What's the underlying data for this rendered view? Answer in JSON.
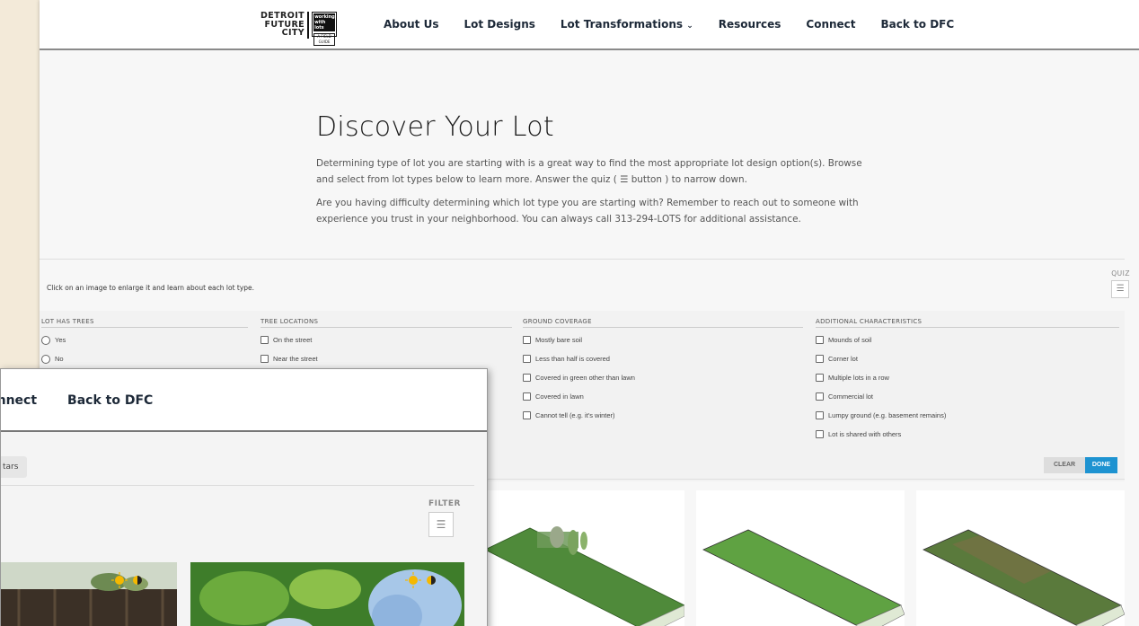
{
  "main": {
    "logo": {
      "line1": "DETROIT",
      "line2": "FUTURE",
      "line3": "CITY",
      "box_line1": "working",
      "box_line2": "with lots",
      "box_sub": "A FIELD GUIDE"
    },
    "nav": [
      "About Us",
      "Lot Designs",
      "Lot Transformations",
      "Resources",
      "Connect",
      "Back to DFC"
    ],
    "hero": {
      "title": "Discover Your Lot",
      "para1": "Determining type of lot you are starting with is a great way to find the most appropriate lot design option(s). Browse and select from lot types below to learn more. Answer the quiz ( ☰ button ) to narrow down.",
      "para2": "Are you having difficulty determining which lot type you are starting with? Remember to reach out to someone with experience you trust in your neighborhood. You can always call 313-294-LOTS for additional assistance."
    },
    "instructions": "Click on an image to enlarge it and learn about each lot type.",
    "quiz_label": "QUIZ",
    "filters": {
      "trees": {
        "head": "LOT HAS TREES",
        "options": [
          "Yes",
          "No"
        ]
      },
      "locations": {
        "head": "TREE LOCATIONS",
        "options": [
          "On the street",
          "Near the street"
        ]
      },
      "ground": {
        "head": "GROUND COVERAGE",
        "options": [
          "Mostly bare soil",
          "Less than half is covered",
          "Covered in green other than lawn",
          "Covered in lawn",
          "Cannot tell (e.g. it's winter)"
        ]
      },
      "additional": {
        "head": "ADDITIONAL CHARACTERISTICS",
        "options": [
          "Mounds of soil",
          "Corner lot",
          "Multiple lots in a row",
          "Commercial lot",
          "Lumpy ground (e.g. basement remains)",
          "Lot is shared with others"
        ]
      }
    },
    "clear_label": "CLEAR",
    "done_label": "DONE"
  },
  "overlay": {
    "nav": [
      "onnect",
      "Back to DFC"
    ],
    "tag": "tars",
    "filter_label": "FILTER"
  },
  "colors": {
    "accent": "#1e93d1",
    "lawn": "#4f9a3e",
    "sun": "#f5b800"
  }
}
